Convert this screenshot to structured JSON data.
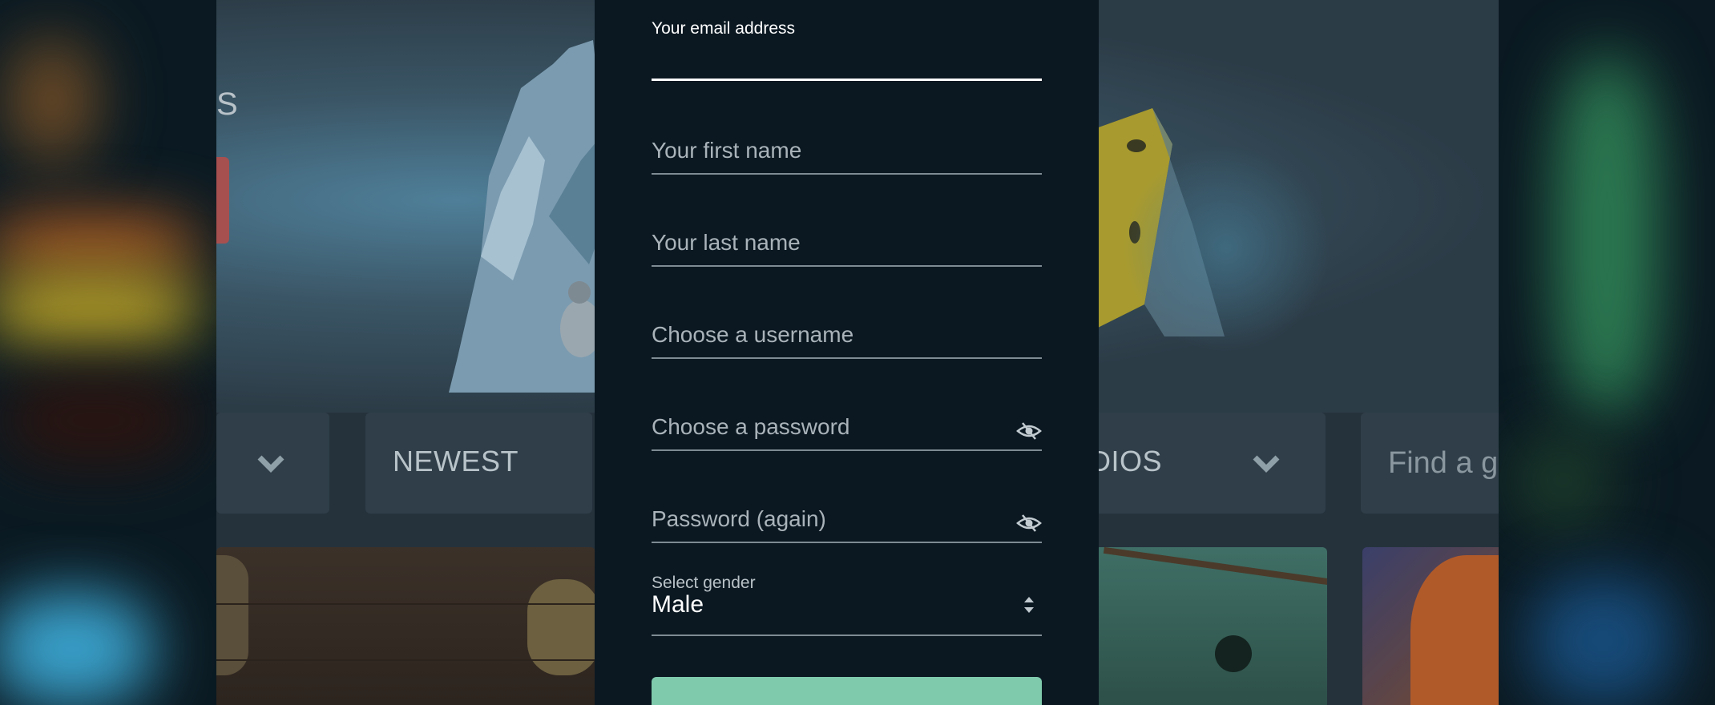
{
  "background": {
    "hero_text": "S",
    "filters": {
      "newest": "NEWEST",
      "studios": "DIOS",
      "search_placeholder": "Find a ga"
    }
  },
  "signup": {
    "email_label": "Your email address",
    "email_value": "",
    "first_name_placeholder": "Your first name",
    "last_name_placeholder": "Your last name",
    "username_placeholder": "Choose a username",
    "password_placeholder": "Choose a password",
    "password_again_placeholder": "Password (again)",
    "gender_label": "Select gender",
    "gender_value": "Male",
    "gender_options": [
      "Male"
    ]
  },
  "colors": {
    "modal_bg": "#0b1822",
    "accent_button": "#7fcaad",
    "overlay": "#25323c"
  },
  "icons": {
    "password_toggle": "eye-slash-icon",
    "dropdown": "chevron-down-icon",
    "select_arrows": "sort-arrows-icon"
  }
}
